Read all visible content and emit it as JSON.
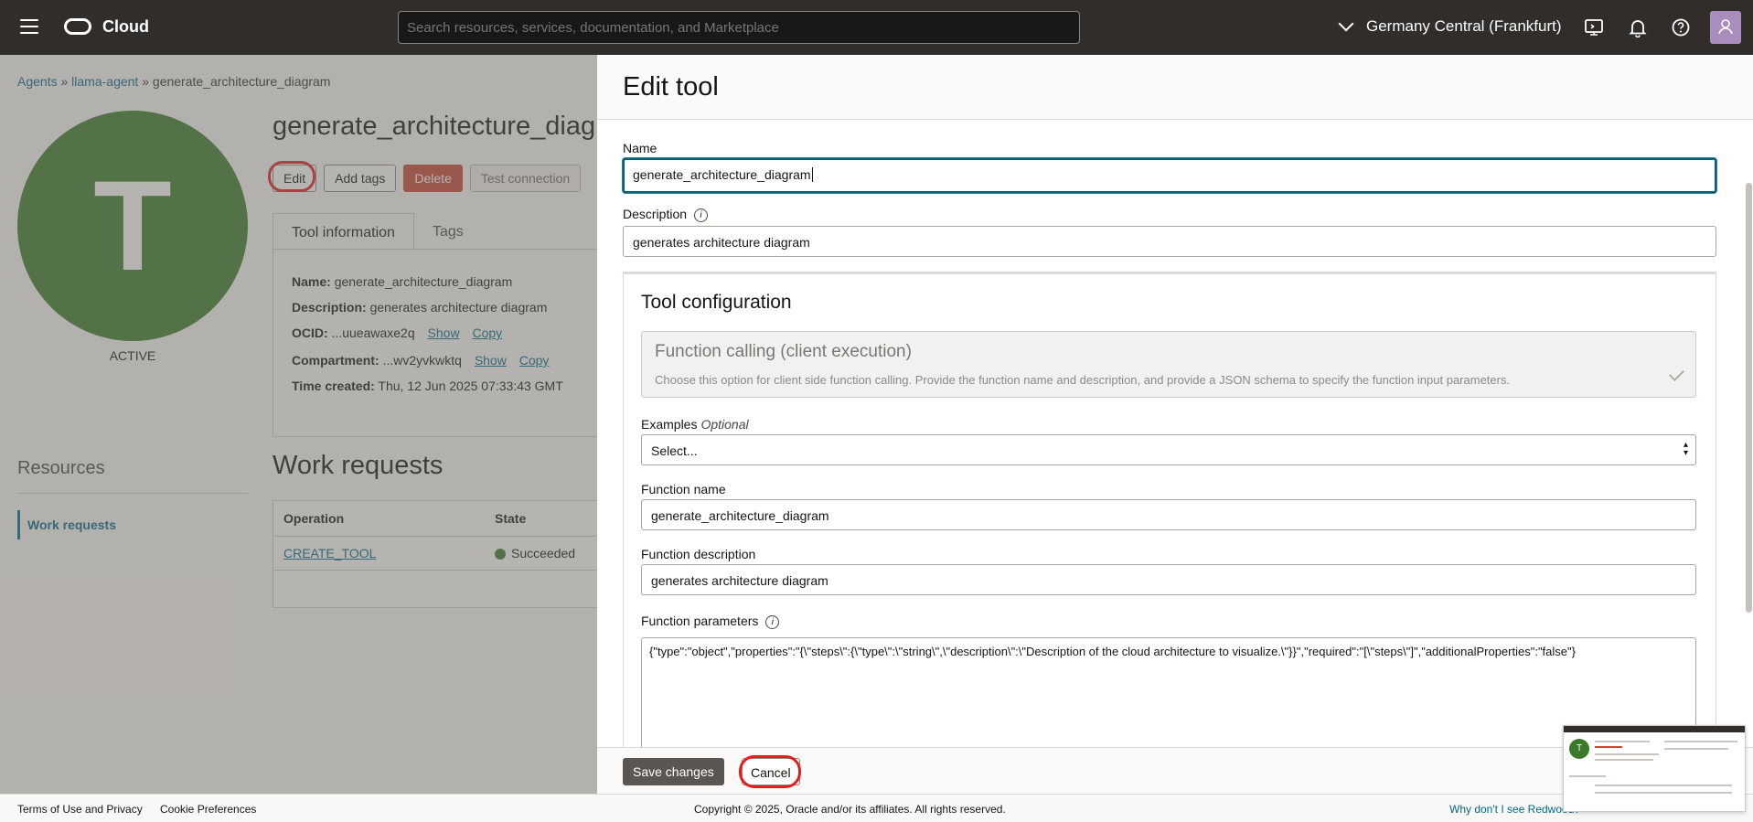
{
  "topbar": {
    "brand": "Cloud",
    "search_placeholder": "Search resources, services, documentation, and Marketplace",
    "region": "Germany Central (Frankfurt)"
  },
  "page": {
    "breadcrumb": [
      "Agents",
      "llama-agent",
      "generate_architecture_diagram"
    ],
    "avatar_letter": "T",
    "status": "ACTIVE",
    "title": "generate_architecture_diagram",
    "buttons": {
      "edit": "Edit",
      "add_tags": "Add tags",
      "delete": "Delete",
      "test_connection": "Test connection"
    },
    "tabs": [
      "Tool information",
      "Tags"
    ],
    "info": {
      "name_label": "Name:",
      "name": "generate_architecture_diagram",
      "description_label": "Description:",
      "description": "generates architecture diagram",
      "ocid_label": "OCID:",
      "ocid": "...uueawaxe2q",
      "compartment_label": "Compartment:",
      "compartment": "...wv2yvkwktq",
      "show": "Show",
      "copy": "Copy",
      "time_label": "Time created:",
      "time": "Thu, 12 Jun 2025 07:33:43 GMT"
    },
    "resources_title": "Resources",
    "resources_item": "Work requests",
    "work_requests_title": "Work requests",
    "table_headers": [
      "Operation",
      "State"
    ],
    "table_rows": [
      {
        "operation": "CREATE_TOOL",
        "state": "Succeeded"
      }
    ]
  },
  "panel": {
    "title": "Edit tool",
    "name_label": "Name",
    "name_value": "generate_architecture_diagram",
    "description_label": "Description",
    "description_value": "generates architecture diagram",
    "config_title": "Tool configuration",
    "function_card_title": "Function calling (client execution)",
    "function_card_desc": "Choose this option for client side function calling. Provide the function name and description, and provide a JSON schema to specify the function input parameters.",
    "examples_label": "Examples",
    "examples_optional": "Optional",
    "examples_value": "Select...",
    "function_name_label": "Function name",
    "function_name_value": "generate_architecture_diagram",
    "function_desc_label": "Function description",
    "function_desc_value": "generates architecture diagram",
    "function_params_label": "Function parameters",
    "function_params_value": "{\"type\":\"object\",\"properties\":\"{\\\"steps\\\":{\\\"type\\\":\\\"string\\\",\\\"description\\\":\\\"Description of the cloud architecture to visualize.\\\"}}\",\"required\":\"[\\\"steps\\\"]\",\"additionalProperties\":\"false\"}",
    "save_label": "Save changes",
    "cancel_label": "Cancel"
  },
  "footer": {
    "terms": "Terms of Use and Privacy",
    "cookies": "Cookie Preferences",
    "copyright": "Copyright © 2025, Oracle and/or its affiliates. All rights reserved.",
    "redwood": "Why don't I see Redwood?"
  },
  "colors": {
    "topbar": "#312d2a",
    "accent_link": "#00688c",
    "avatar_green": "#3a7a2a",
    "delete_red": "#c74634",
    "annotation_red": "#e51c1c"
  }
}
